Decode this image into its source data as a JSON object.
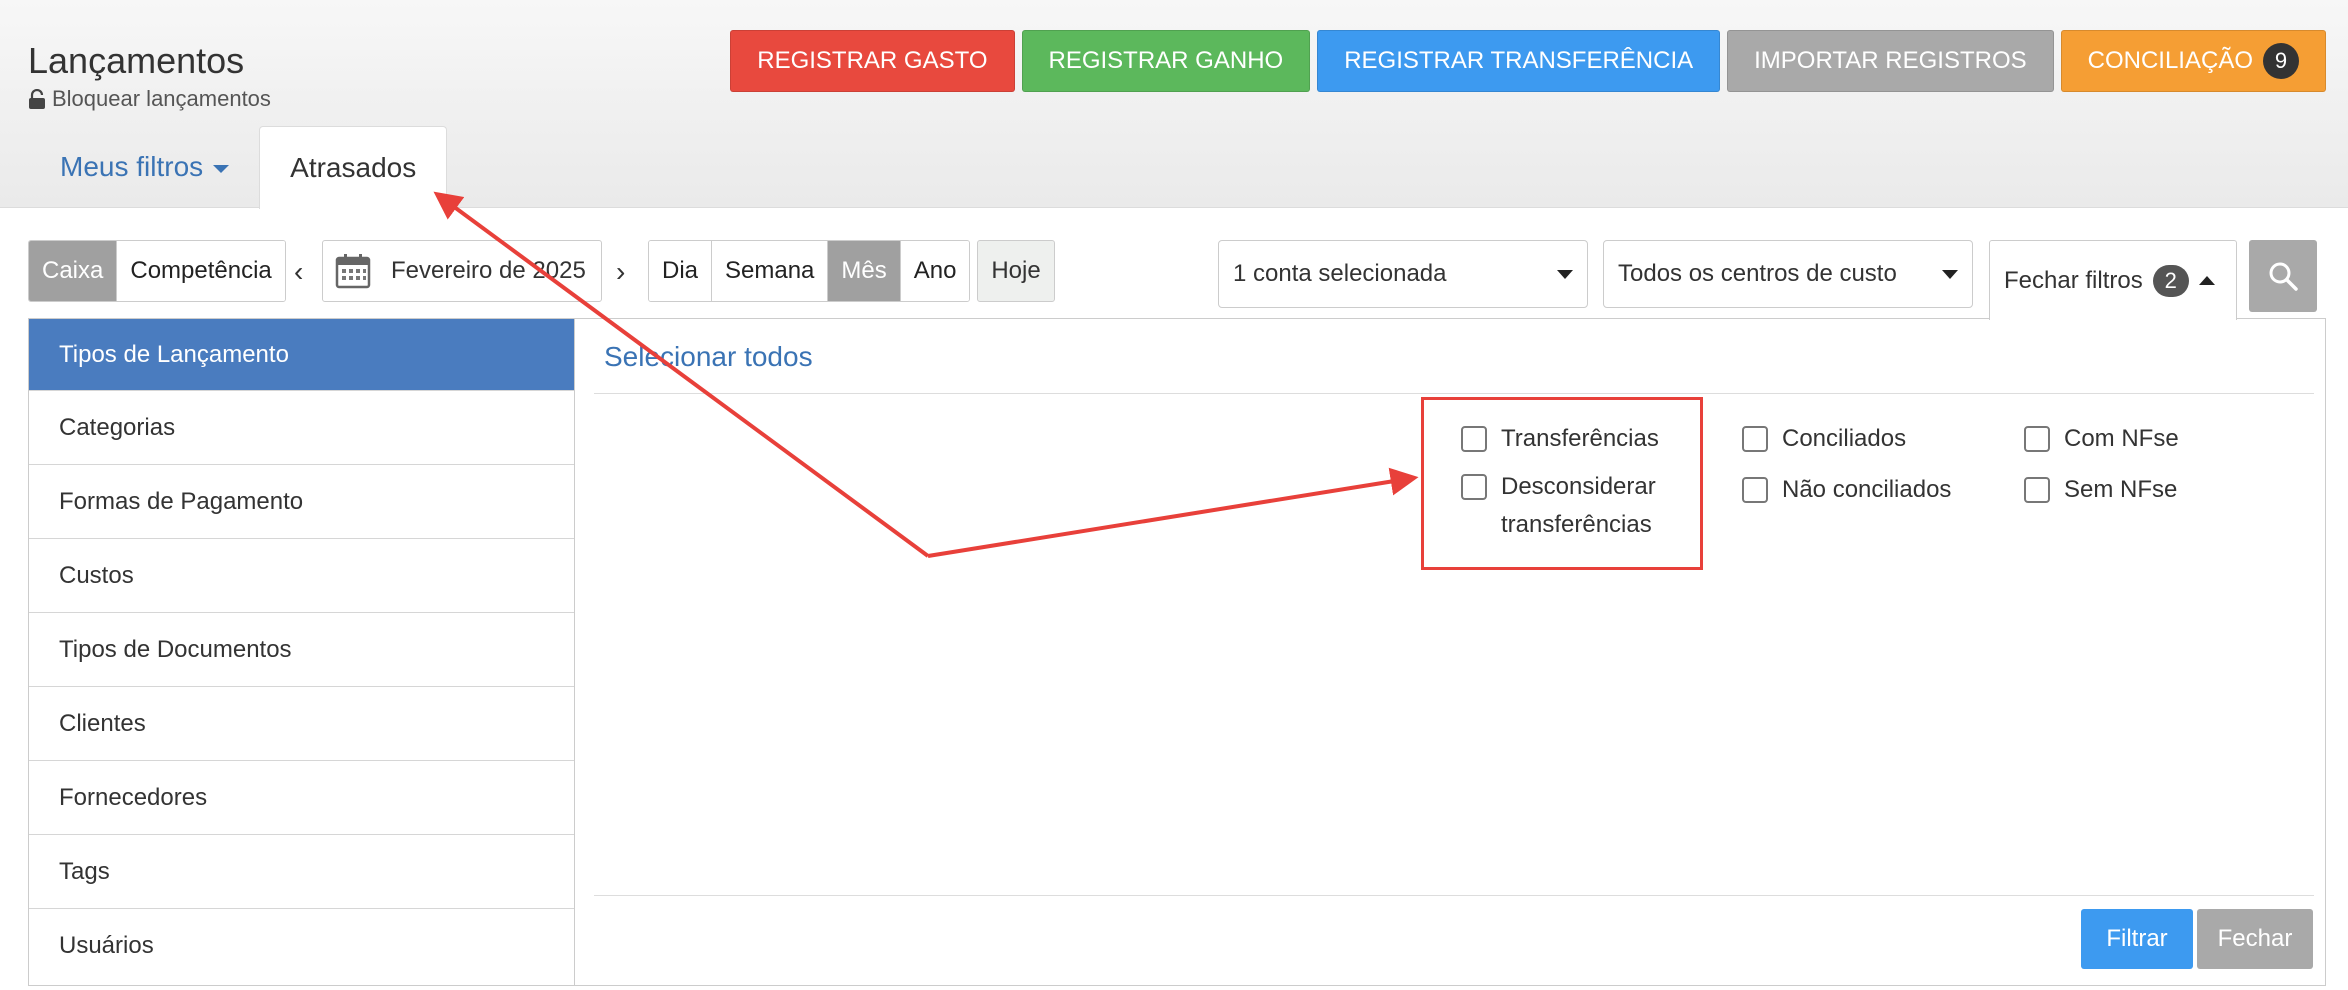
{
  "header": {
    "title": "Lançamentos",
    "lock_label": "Bloquear lançamentos",
    "actions": {
      "registrar_gasto": "REGISTRAR GASTO",
      "registrar_ganho": "REGISTRAR GANHO",
      "registrar_transferencia": "REGISTRAR TRANSFERÊNCIA",
      "importar_registros": "IMPORTAR REGISTROS",
      "conciliacao": "CONCILIAÇÃO",
      "conciliacao_count": "9"
    },
    "tabs": {
      "meus_filtros": "Meus filtros",
      "atrasados": "Atrasados"
    }
  },
  "toolbar": {
    "regime": [
      "Caixa",
      "Competência"
    ],
    "regime_selected": "Caixa",
    "prev_arrow": "‹",
    "next_arrow": "›",
    "period": "Fevereiro de 2025",
    "granularity": [
      "Dia",
      "Semana",
      "Mês",
      "Ano"
    ],
    "granularity_selected": "Mês",
    "today": "Hoje",
    "account_select": "1 conta selecionada",
    "cost_center_select": "Todos os centros de custo",
    "close_filters": "Fechar filtros",
    "active_filters_count": "2"
  },
  "filter_panel": {
    "categories": [
      "Tipos de Lançamento",
      "Categorias",
      "Formas de Pagamento",
      "Custos",
      "Tipos de Documentos",
      "Clientes",
      "Fornecedores",
      "Tags",
      "Usuários"
    ],
    "active_category": "Tipos de Lançamento",
    "select_all": "Selecionar todos",
    "options": {
      "transferencias": "Transferências",
      "desconsiderar_line1": "Desconsiderar",
      "desconsiderar_line2": "transferências",
      "conciliados": "Conciliados",
      "nao_conciliados": "Não conciliados",
      "com_nfse": "Com NFse",
      "sem_nfse": "Sem NFse"
    },
    "apply": "Filtrar",
    "close": "Fechar"
  },
  "colors": {
    "red": "#e8493e",
    "green": "#5cb85c",
    "blue": "#3d9af0",
    "gray": "#a9a9a9",
    "orange": "#f59e34",
    "link": "#3a73b4",
    "active_sidebar": "#4a7cbf",
    "annotation": "#e8403a"
  }
}
